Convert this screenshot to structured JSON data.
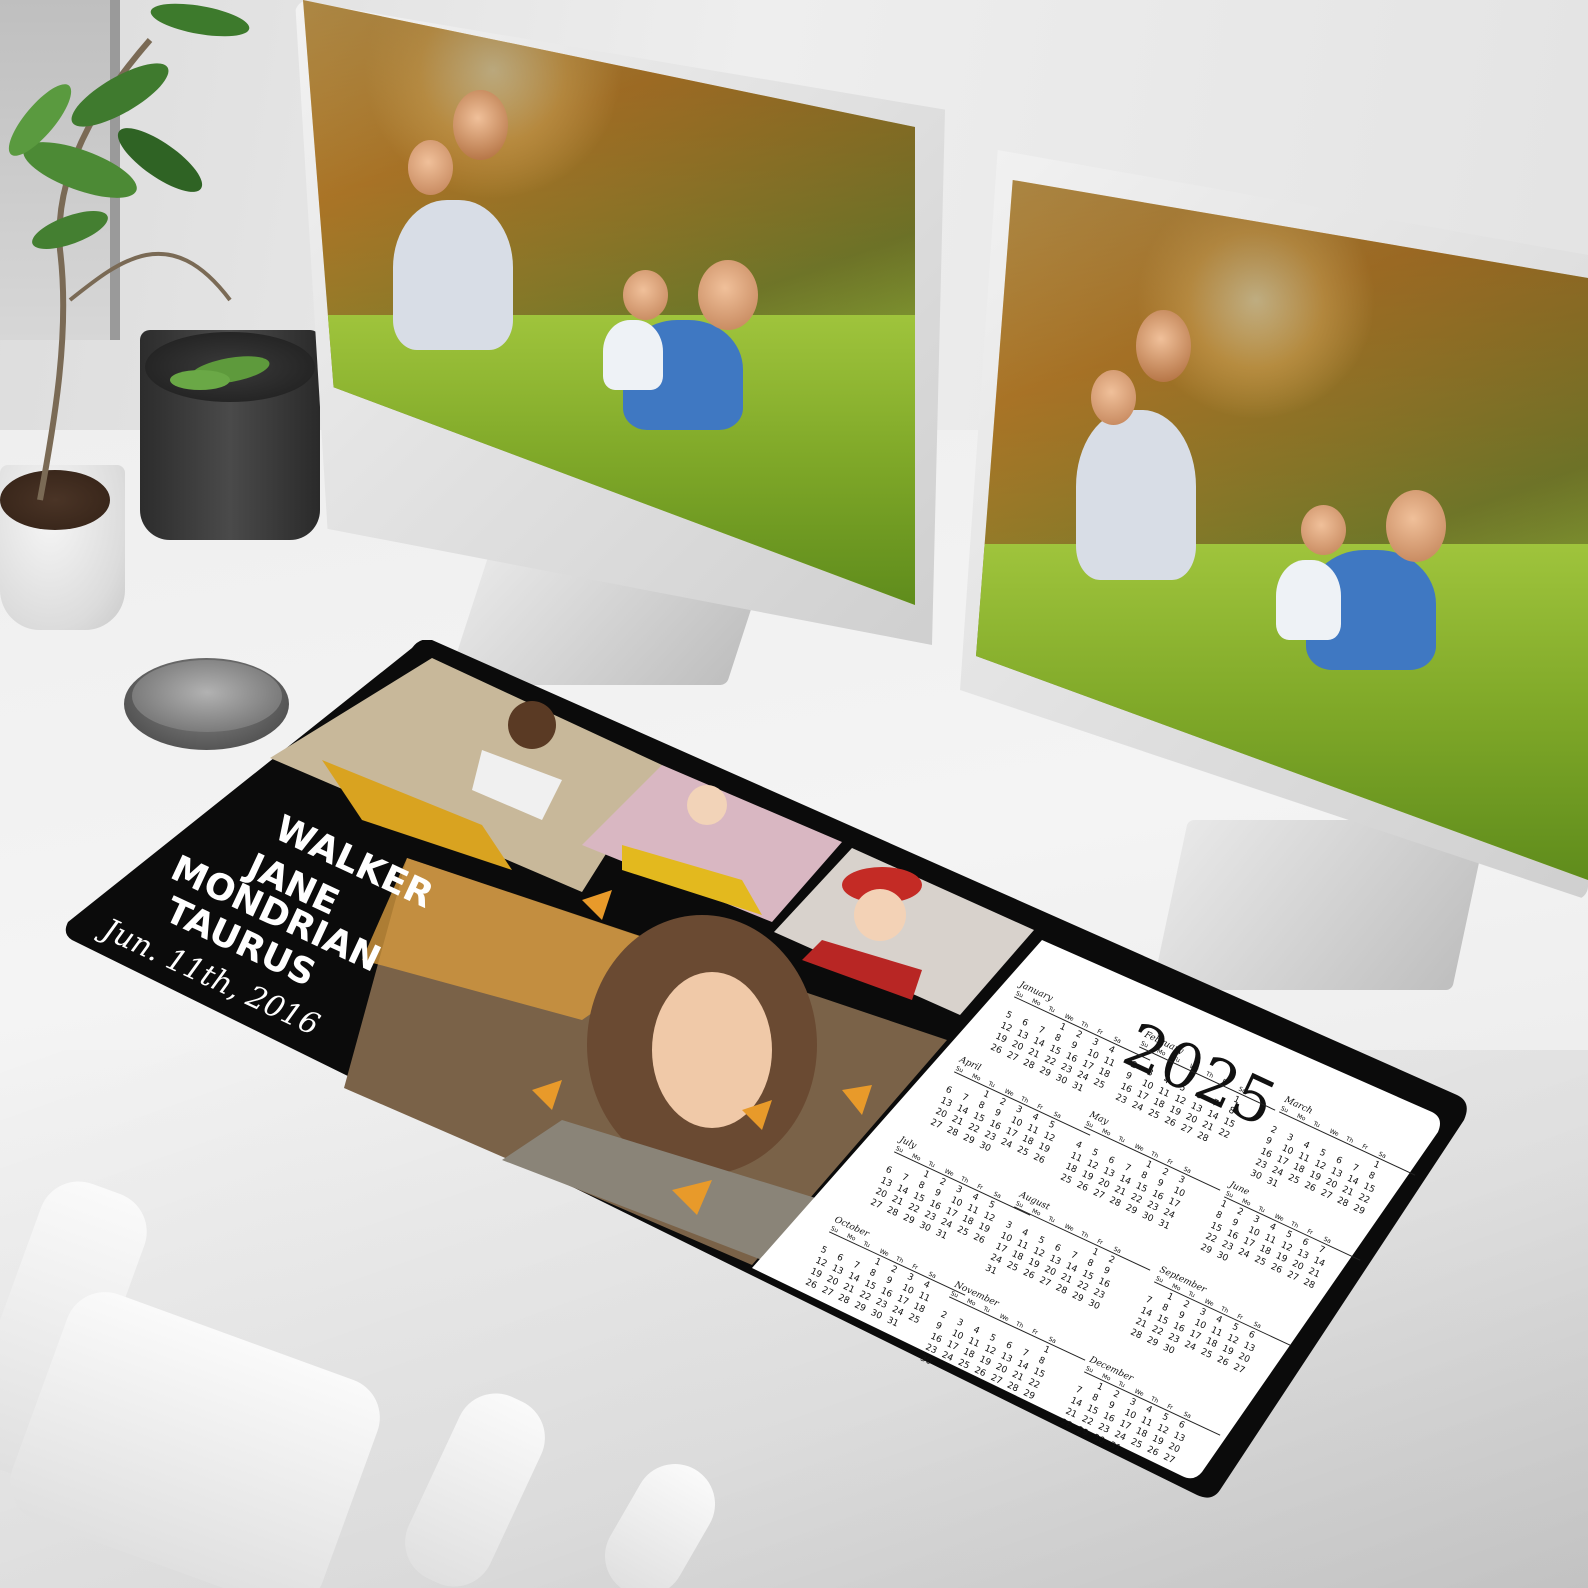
{
  "mat": {
    "name_lines": [
      "WALKER",
      "JANE",
      "MONDRIAN",
      "TAURUS"
    ],
    "date_line": "Jun. 11th, 2016"
  },
  "calendar": {
    "year": "2025",
    "months": [
      {
        "name": "January",
        "offset": 3,
        "days": 31
      },
      {
        "name": "February",
        "offset": 6,
        "days": 28
      },
      {
        "name": "March",
        "offset": 6,
        "days": 31
      },
      {
        "name": "April",
        "offset": 2,
        "days": 30
      },
      {
        "name": "May",
        "offset": 4,
        "days": 31
      },
      {
        "name": "June",
        "offset": 0,
        "days": 30
      },
      {
        "name": "July",
        "offset": 2,
        "days": 31
      },
      {
        "name": "August",
        "offset": 5,
        "days": 31
      },
      {
        "name": "September",
        "offset": 1,
        "days": 30
      },
      {
        "name": "October",
        "offset": 3,
        "days": 31
      },
      {
        "name": "November",
        "offset": 6,
        "days": 30
      },
      {
        "name": "December",
        "offset": 1,
        "days": 31
      }
    ],
    "weekdays": [
      "Su",
      "Mo",
      "Tu",
      "We",
      "Th",
      "Fr",
      "Sa"
    ]
  },
  "colors": {
    "mat_black": "#0b0b0b",
    "calendar_bg": "#ffffff",
    "accent_orange": "#e0a030",
    "grass_green": "#8bb83a"
  }
}
